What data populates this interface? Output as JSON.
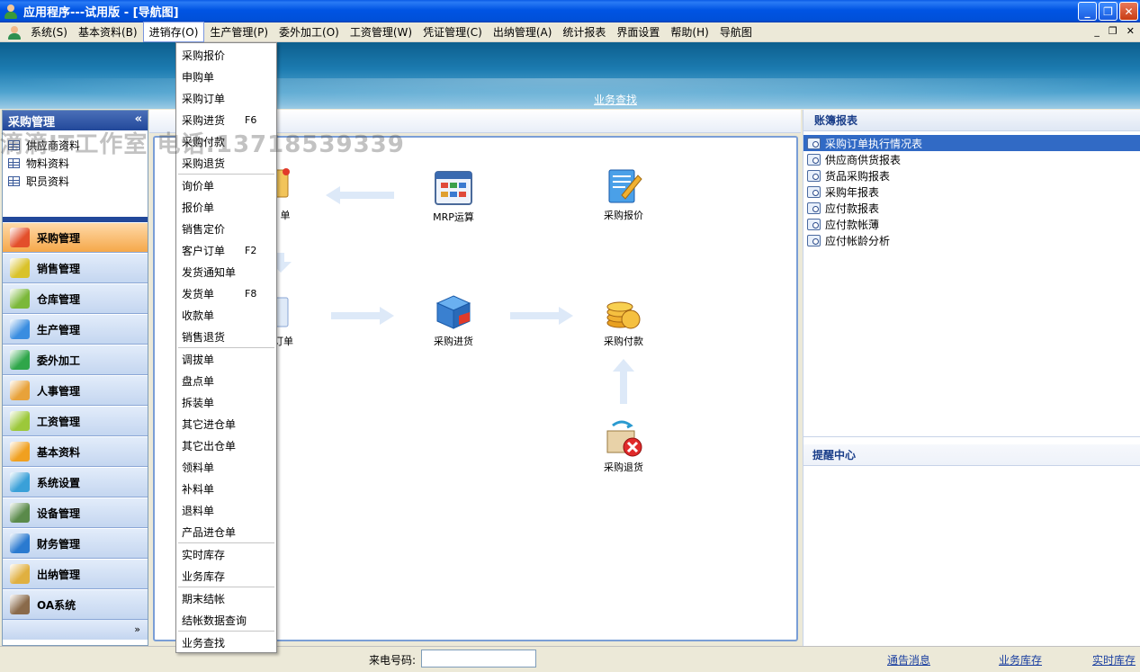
{
  "window": {
    "title": "应用程序---试用版 - [导航图]",
    "minimize": "_",
    "restore": "❐",
    "close": "✕"
  },
  "menubar": {
    "items": [
      "系统(S)",
      "基本资料(B)",
      "进销存(O)",
      "生产管理(P)",
      "委外加工(O)",
      "工资管理(W)",
      "凭证管理(C)",
      "出纳管理(A)",
      "统计报表",
      "界面设置",
      "帮助(H)",
      "导航图"
    ],
    "mdi_minimize": "_",
    "mdi_restore": "❐",
    "mdi_close": "✕"
  },
  "banner": {
    "search_link": "业务查找"
  },
  "left_panel": {
    "title": "采购管理",
    "collapse_glyph": "«",
    "items": [
      "供应商资料",
      "物料资料",
      "职员资料"
    ],
    "nav": [
      {
        "label": "采购管理",
        "icon": "purchase-icon",
        "color": "#e34f2b"
      },
      {
        "label": "销售管理",
        "icon": "sales-icon",
        "color": "#d9c22a"
      },
      {
        "label": "仓库管理",
        "icon": "warehouse-icon",
        "color": "#7bb83a"
      },
      {
        "label": "生产管理",
        "icon": "production-icon",
        "color": "#3a8de0"
      },
      {
        "label": "委外加工",
        "icon": "outsourcing-icon",
        "color": "#2fa64a"
      },
      {
        "label": "人事管理",
        "icon": "personnel-icon",
        "color": "#e8a23a"
      },
      {
        "label": "工资管理",
        "icon": "salary-icon",
        "color": "#9cc83a"
      },
      {
        "label": "基本资料",
        "icon": "basic-data-icon",
        "color": "#f0a020"
      },
      {
        "label": "系统设置",
        "icon": "settings-icon",
        "color": "#3aa0d8"
      },
      {
        "label": "设备管理",
        "icon": "equipment-icon",
        "color": "#5a8a4a"
      },
      {
        "label": "财务管理",
        "icon": "finance-icon",
        "color": "#2a7ad0"
      },
      {
        "label": "出纳管理",
        "icon": "cashier-icon",
        "color": "#e0b040"
      },
      {
        "label": "OA系统",
        "icon": "oa-icon",
        "color": "#8a6a4a"
      }
    ],
    "more_glyph": "»"
  },
  "watermark": "滴滴IT工作室 电话:13718539339",
  "workflow": {
    "nodes": {
      "order_partial": "单",
      "mrp": "MRP运算",
      "quote": "采购报价",
      "order_partial2": "订单",
      "receiving": "采购进货",
      "payment": "采购付款",
      "return": "采购退货"
    }
  },
  "dropdown": {
    "groups": [
      [
        {
          "label": "采购报价",
          "shortcut": ""
        },
        {
          "label": "申购单",
          "shortcut": ""
        },
        {
          "label": "采购订单",
          "shortcut": ""
        },
        {
          "label": "采购进货",
          "shortcut": "F6"
        },
        {
          "label": "采购付款",
          "shortcut": ""
        },
        {
          "label": "采购退货",
          "shortcut": ""
        }
      ],
      [
        {
          "label": "询价单",
          "shortcut": ""
        },
        {
          "label": "报价单",
          "shortcut": ""
        },
        {
          "label": "销售定价",
          "shortcut": ""
        },
        {
          "label": "客户订单",
          "shortcut": "F2"
        },
        {
          "label": "发货通知单",
          "shortcut": ""
        },
        {
          "label": "发货单",
          "shortcut": "F8"
        },
        {
          "label": "收款单",
          "shortcut": ""
        },
        {
          "label": "销售退货",
          "shortcut": ""
        }
      ],
      [
        {
          "label": "调拔单",
          "shortcut": ""
        },
        {
          "label": "盘点单",
          "shortcut": ""
        },
        {
          "label": "拆装单",
          "shortcut": ""
        },
        {
          "label": "其它进仓单",
          "shortcut": ""
        },
        {
          "label": "其它出仓单",
          "shortcut": ""
        },
        {
          "label": "领料单",
          "shortcut": ""
        },
        {
          "label": "补料单",
          "shortcut": ""
        },
        {
          "label": "退料单",
          "shortcut": ""
        },
        {
          "label": "产品进仓单",
          "shortcut": ""
        }
      ],
      [
        {
          "label": "实时库存",
          "shortcut": ""
        },
        {
          "label": "业务库存",
          "shortcut": ""
        }
      ],
      [
        {
          "label": "期末结帐",
          "shortcut": ""
        },
        {
          "label": "结帐数据查询",
          "shortcut": ""
        }
      ],
      [
        {
          "label": "业务查找",
          "shortcut": ""
        }
      ]
    ]
  },
  "right_panel": {
    "title": "账簿报表",
    "reports": [
      "采购订单执行情况表",
      "供应商供货报表",
      "货品采购报表",
      "采购年报表",
      "应付款报表",
      "应付款帐薄",
      "应付帐龄分析"
    ],
    "remind_title": "提醒中心"
  },
  "statusbar": {
    "caller_label": "来电号码:",
    "caller_value": "",
    "links": [
      "通告消息",
      "业务库存",
      "实时库存"
    ]
  }
}
